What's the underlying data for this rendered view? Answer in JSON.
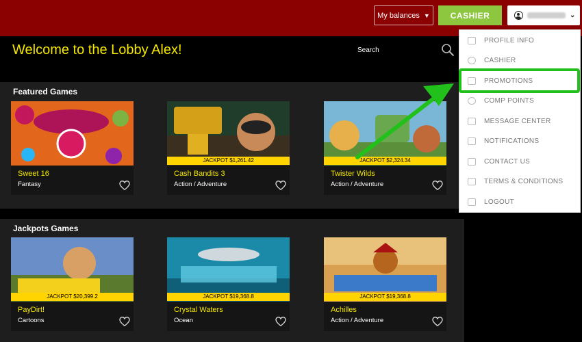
{
  "topbar": {
    "balances_label": "My balances",
    "cashier_label": "CASHIER"
  },
  "lobby": {
    "welcome": "Welcome to the Lobby Alex!",
    "search_label": "Search"
  },
  "featured": {
    "title": "Featured Games",
    "games": [
      {
        "title": "Sweet 16",
        "genre": "Fantasy",
        "jackpot": ""
      },
      {
        "title": "Cash Bandits 3",
        "genre": "Action / Adventure",
        "jackpot": "JACKPOT $1,261.42"
      },
      {
        "title": "Twister Wilds",
        "genre": "Action / Adventure",
        "jackpot": "JACKPOT $2,324.34"
      }
    ]
  },
  "jackpots": {
    "title": "Jackpots Games",
    "games": [
      {
        "title": "PayDirt!",
        "genre": "Cartoons",
        "jackpot": "JACKPOT $20,399.2"
      },
      {
        "title": "Crystal Waters",
        "genre": "Ocean",
        "jackpot": "JACKPOT $19,368.8"
      },
      {
        "title": "Achilles",
        "genre": "Action / Adventure",
        "jackpot": "JACKPOT $19,368.8"
      }
    ]
  },
  "user_menu": {
    "items": [
      {
        "label": "PROFILE INFO",
        "icon": "id-card-icon"
      },
      {
        "label": "CASHIER",
        "icon": "money-bag-icon"
      },
      {
        "label": "PROMOTIONS",
        "icon": "gift-icon"
      },
      {
        "label": "COMP POINTS",
        "icon": "chip-icon"
      },
      {
        "label": "MESSAGE CENTER",
        "icon": "envelope-icon"
      },
      {
        "label": "NOTIFICATIONS",
        "icon": "notification-icon"
      },
      {
        "label": "CONTACT US",
        "icon": "contact-icon"
      },
      {
        "label": "TERMS & CONDITIONS",
        "icon": "document-icon"
      },
      {
        "label": "LOGOUT",
        "icon": "logout-icon"
      }
    ],
    "highlighted_item": "PROMOTIONS"
  },
  "colors": {
    "topbar": "#8b0000",
    "cashier_button": "#8dc63f",
    "accent_text": "#f5e800",
    "jackpot_bar": "#ffd400",
    "highlight": "#22c01a"
  }
}
